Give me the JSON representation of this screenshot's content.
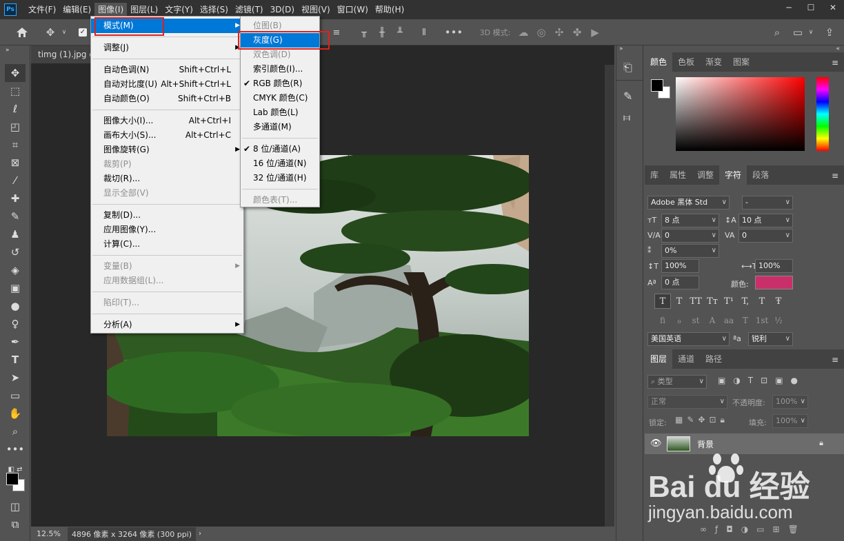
{
  "app": {
    "logo": "Ps"
  },
  "menubar": [
    "文件(F)",
    "编辑(E)",
    "图像(I)",
    "图层(L)",
    "文字(Y)",
    "选择(S)",
    "滤镜(T)",
    "3D(D)",
    "视图(V)",
    "窗口(W)",
    "帮助(H)"
  ],
  "window_controls": [
    "─",
    "☐",
    "✕"
  ],
  "options_bar": {
    "mode3d_label": "3D 模式:"
  },
  "document": {
    "tab_title": "timg (1).jpg @"
  },
  "status": {
    "zoom": "12.5%",
    "info": "4896 像素 x 3264 像素 (300 ppi)"
  },
  "image_menu": {
    "groups": [
      [
        {
          "label": "模式(M)",
          "shortcut": "",
          "submenu": true,
          "highlighted": true
        }
      ],
      [
        {
          "label": "调整(J)",
          "shortcut": "",
          "submenu": true
        }
      ],
      [
        {
          "label": "自动色调(N)",
          "shortcut": "Shift+Ctrl+L"
        },
        {
          "label": "自动对比度(U)",
          "shortcut": "Alt+Shift+Ctrl+L"
        },
        {
          "label": "自动颜色(O)",
          "shortcut": "Shift+Ctrl+B"
        }
      ],
      [
        {
          "label": "图像大小(I)...",
          "shortcut": "Alt+Ctrl+I"
        },
        {
          "label": "画布大小(S)...",
          "shortcut": "Alt+Ctrl+C"
        },
        {
          "label": "图像旋转(G)",
          "shortcut": "",
          "submenu": true
        },
        {
          "label": "裁剪(P)",
          "shortcut": "",
          "disabled": true
        },
        {
          "label": "裁切(R)...",
          "shortcut": ""
        },
        {
          "label": "显示全部(V)",
          "shortcut": "",
          "disabled": true
        }
      ],
      [
        {
          "label": "复制(D)...",
          "shortcut": ""
        },
        {
          "label": "应用图像(Y)...",
          "shortcut": ""
        },
        {
          "label": "计算(C)...",
          "shortcut": ""
        }
      ],
      [
        {
          "label": "变量(B)",
          "shortcut": "",
          "submenu": true,
          "disabled": true
        },
        {
          "label": "应用数据组(L)...",
          "shortcut": "",
          "disabled": true
        }
      ],
      [
        {
          "label": "陷印(T)...",
          "shortcut": "",
          "disabled": true
        }
      ],
      [
        {
          "label": "分析(A)",
          "shortcut": "",
          "submenu": true
        }
      ]
    ]
  },
  "mode_submenu": {
    "groups": [
      [
        {
          "label": "位图(B)",
          "disabled": true
        },
        {
          "label": "灰度(G)",
          "highlighted": true
        },
        {
          "label": "双色调(D)",
          "disabled": true
        },
        {
          "label": "索引颜色(I)..."
        },
        {
          "label": "RGB 颜色(R)",
          "checked": true
        },
        {
          "label": "CMYK 颜色(C)"
        },
        {
          "label": "Lab 颜色(L)"
        },
        {
          "label": "多通道(M)"
        }
      ],
      [
        {
          "label": "8 位/通道(A)",
          "checked": true
        },
        {
          "label": "16 位/通道(N)"
        },
        {
          "label": "32 位/通道(H)"
        }
      ],
      [
        {
          "label": "颜色表(T)...",
          "disabled": true
        }
      ]
    ]
  },
  "color_panel": {
    "tabs": [
      "颜色",
      "色板",
      "渐变",
      "图案"
    ]
  },
  "char_panel": {
    "tabs": [
      "库",
      "属性",
      "调整",
      "字符",
      "段落"
    ],
    "font_family": "Adobe 黑体 Std",
    "font_style": "-",
    "font_size": "8 点",
    "leading": "10 点",
    "kerning": "0",
    "tracking": "0",
    "tsume": "0%",
    "vscale": "100%",
    "hscale": "100%",
    "baseline": "0 点",
    "color_label": "颜色:",
    "text_color": "#c9306a",
    "style_buttons": [
      "T",
      "T",
      "TT",
      "Tт",
      "T¹",
      "T,",
      "T",
      "Ŧ"
    ],
    "opentype_buttons": [
      "fi",
      "ℴ",
      "st",
      "A",
      "aa",
      "T",
      "1st",
      "½"
    ],
    "language": "美国英语",
    "aa_label": "ªa",
    "antialias": "锐利"
  },
  "layers_panel": {
    "tabs": [
      "图层",
      "通道",
      "路径"
    ],
    "filter": "类型",
    "blend": "正常",
    "opacity_label": "不透明度:",
    "opacity": "100%",
    "lock_label": "锁定:",
    "fill_label": "填充:",
    "fill": "100%",
    "layer_name": "背景"
  },
  "watermark": {
    "brand": "Bai du 经验",
    "url": "jingyan.baidu.com"
  }
}
